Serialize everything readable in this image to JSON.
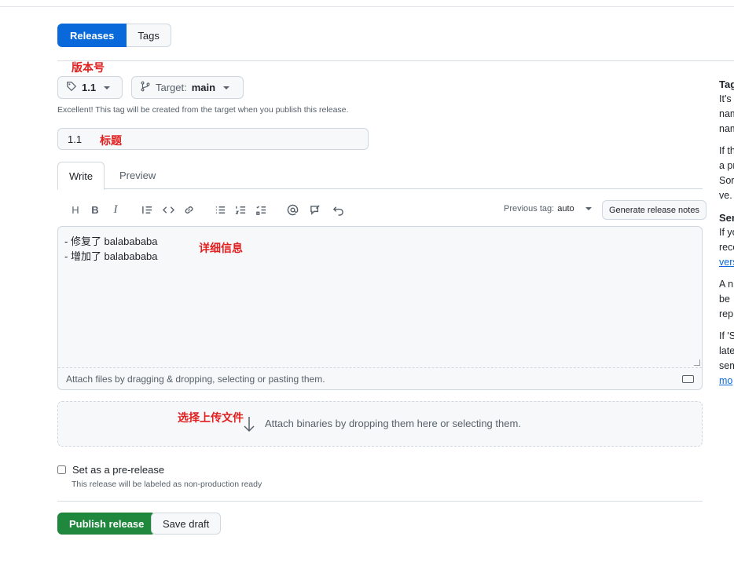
{
  "tabs_top": {
    "releases": "Releases",
    "tags": "Tags"
  },
  "annotations": {
    "version": "版本号",
    "title": "标题",
    "details": "详细信息",
    "upload": "选择上传文件"
  },
  "tag_select": {
    "value": "1.1"
  },
  "target_select": {
    "label": "Target:",
    "value": "main"
  },
  "tag_hint": "Excellent! This tag will be created from the target when you publish this release.",
  "release_title": "1.1",
  "editor_tabs": {
    "write": "Write",
    "preview": "Preview"
  },
  "toolbar": {
    "heading": "H",
    "bold": "B",
    "italic": "I",
    "previous_tag_label": "Previous tag:",
    "previous_tag_value": "auto",
    "generate_notes": "Generate release notes"
  },
  "editor": {
    "line1": "- 修复了 balabababa",
    "line2": "- 增加了 balabababa",
    "attach_text": "Attach files by dragging & dropping, selecting or pasting them."
  },
  "binaries_text": "Attach binaries by dropping them here or selecting them.",
  "prerelease": {
    "label": "Set as a pre-release",
    "hint": "This release will be labeled as non-production ready",
    "checked": false
  },
  "buttons": {
    "publish": "Publish release",
    "draft": "Save draft"
  },
  "sidebar": {
    "lines": [
      "Tag",
      "It's",
      "nam",
      "nam",
      "If th",
      "a pr",
      "Sor",
      "ve.",
      "Sen",
      "If yo",
      "reco",
      "vers",
      "A n",
      "be",
      "rep",
      "If 'S",
      "late",
      "sem",
      "mo"
    ]
  },
  "colors": {
    "accent": "#0969da",
    "publish": "#1f883d",
    "annotation": "#e0201f"
  }
}
